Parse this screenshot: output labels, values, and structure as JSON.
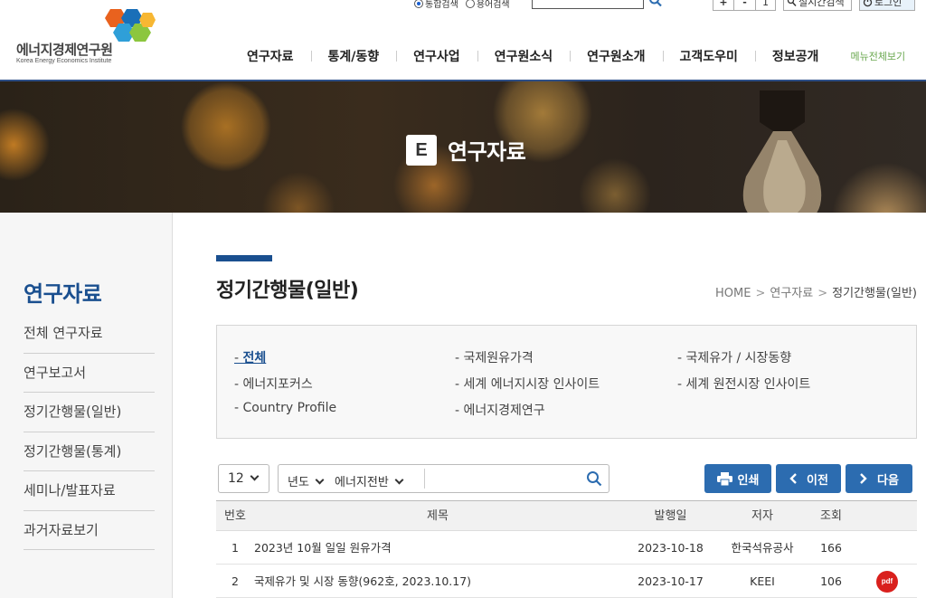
{
  "header": {
    "logo_text": "에너지경제연구원",
    "logo_sub": "Korea Energy Economics Institute",
    "search_options": [
      "통합검색",
      "용어검색"
    ],
    "zoom": {
      "plus": "+",
      "minus": "-",
      "value": "1"
    },
    "realtime_search": "실시간검색",
    "login": "로그인",
    "nav": [
      "연구자료",
      "통계/동향",
      "연구사업",
      "연구원소식",
      "연구원소개",
      "고객도우미",
      "정보공개"
    ],
    "all_menu": "메뉴전체보기"
  },
  "banner": {
    "badge": "E",
    "title": "연구자료"
  },
  "sidebar": {
    "title": "연구자료",
    "items": [
      "전체 연구자료",
      "연구보고서",
      "정기간행물(일반)",
      "정기간행물(통계)",
      "세미나/발표자료",
      "과거자료보기"
    ]
  },
  "page": {
    "title": "정기간행물(일반)",
    "breadcrumb": [
      "HOME",
      "연구자료",
      "정기간행물(일반)"
    ],
    "breadcrumb_sep": ">"
  },
  "categories": [
    {
      "label": "전체",
      "active": true
    },
    {
      "label": "국제원유가격"
    },
    {
      "label": "국제유가 / 시장동향"
    },
    {
      "label": "에너지포커스"
    },
    {
      "label": "세계 에너지시장 인사이트"
    },
    {
      "label": "세계 원전시장 인사이트"
    },
    {
      "label": "Country Profile"
    },
    {
      "label": "에너지경제연구"
    }
  ],
  "toolbar": {
    "page_size": "12",
    "year_label": "년도",
    "category_label": "에너지전반",
    "search_placeholder": "",
    "print": "인쇄",
    "prev": "이전",
    "next": "다음"
  },
  "table": {
    "headers": {
      "no": "번호",
      "title": "제목",
      "date": "발행일",
      "author": "저자",
      "views": "조회"
    },
    "rows": [
      {
        "no": "1",
        "title": "2023년 10월 일일 원유가격",
        "date": "2023-10-18",
        "author": "한국석유공사",
        "views": "166",
        "pdf": false
      },
      {
        "no": "2",
        "title": "국제유가 및 시장 동향(962호, 2023.10.17)",
        "date": "2023-10-17",
        "author": "KEEI",
        "views": "106",
        "pdf": true
      }
    ],
    "pdf_label": "pdf"
  },
  "colors": {
    "primary": "#1a4f8f",
    "button": "#2c6cb0",
    "pdf": "#d9201d",
    "all_menu": "#6aa84f"
  }
}
